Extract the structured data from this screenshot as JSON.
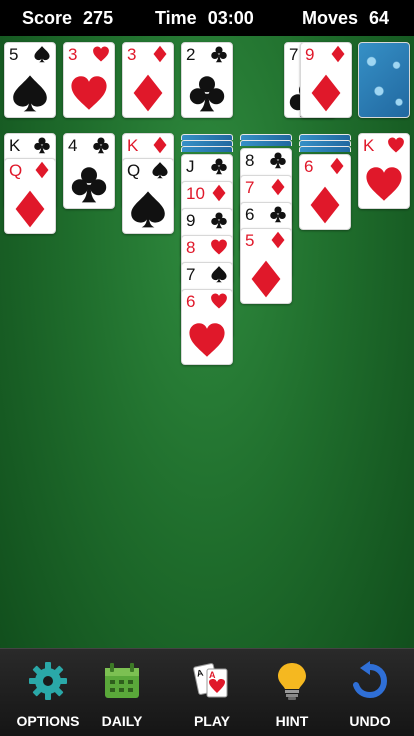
{
  "topbar": {
    "score_label": "Score",
    "score_value": "275",
    "time_label": "Time",
    "time_value": "03:00",
    "moves_label": "Moves",
    "moves_value": "64"
  },
  "foundations": [
    {
      "rank": "5",
      "suit": "spades",
      "color": "black"
    },
    {
      "rank": "3",
      "suit": "hearts",
      "color": "red"
    },
    {
      "rank": "3",
      "suit": "diamonds",
      "color": "red"
    },
    {
      "rank": "2",
      "suit": "clubs",
      "color": "black"
    }
  ],
  "waste": {
    "under_rank": "7",
    "under_suit": "clubs",
    "top_rank": "9",
    "top_suit": "diamonds"
  },
  "tableau": [
    {
      "cards": [
        {
          "rank": "K",
          "suit": "clubs"
        },
        {
          "rank": "Q",
          "suit": "diamonds"
        }
      ]
    },
    {
      "cards": [
        {
          "rank": "4",
          "suit": "clubs"
        }
      ]
    },
    {
      "cards": [
        {
          "rank": "K",
          "suit": "diamonds"
        },
        {
          "rank": "Q",
          "suit": "spades"
        }
      ]
    },
    {
      "cards": [
        {
          "rank": "J",
          "suit": "clubs"
        },
        {
          "rank": "10",
          "suit": "diamonds"
        },
        {
          "rank": "9",
          "suit": "clubs"
        },
        {
          "rank": "8",
          "suit": "hearts"
        },
        {
          "rank": "7",
          "suit": "spades"
        },
        {
          "rank": "6",
          "suit": "hearts"
        }
      ]
    },
    {
      "cards": [
        {
          "rank": "8",
          "suit": "clubs"
        },
        {
          "rank": "7",
          "suit": "diamonds"
        },
        {
          "rank": "6",
          "suit": "clubs"
        },
        {
          "rank": "5",
          "suit": "diamonds"
        }
      ]
    },
    {
      "cards": [
        {
          "rank": "6",
          "suit": "diamonds"
        }
      ]
    },
    {
      "cards": [
        {
          "rank": "K",
          "suit": "hearts"
        }
      ]
    }
  ],
  "toolbar": {
    "options_label": "OPTIONS",
    "daily_label": "DAILY",
    "play_label": "PLAY",
    "hint_label": "HINT",
    "undo_label": "UNDO"
  },
  "colors": {
    "felt": "#1f6d2c",
    "red_suit": "#e0182a",
    "black_suit": "#111111",
    "card_back": "#2b7fb8"
  },
  "icons": {
    "options": "gear-icon",
    "daily": "calendar-icon",
    "play": "cards-icon",
    "hint": "lightbulb-icon",
    "undo": "undo-arrow-icon"
  }
}
